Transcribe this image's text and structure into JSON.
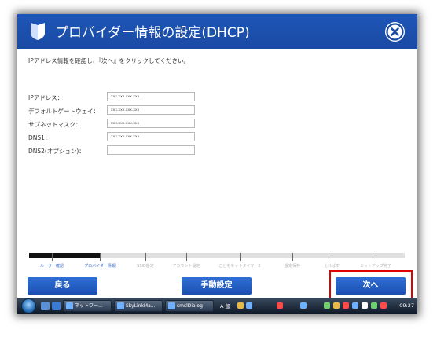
{
  "window": {
    "title": "プロバイダー情報の設定(DHCP)",
    "logo_icon": "shield-icon",
    "close_icon": "close-circle-icon"
  },
  "instruction": "IPアドレス情報を確認し、『次へ』をクリックしてください。",
  "form": [
    {
      "label": "IPアドレス：",
      "value": "xxx.xxx.xxx.xxx"
    },
    {
      "label": "デフォルトゲートウェイ：",
      "value": "xxx.xxx.xxx.xxx"
    },
    {
      "label": "サブネットマスク：",
      "value": "xxx.xxx.xxx.xxx"
    },
    {
      "label": "DNS1：",
      "value": "xxx.xxx.xxx.xxx"
    },
    {
      "label": "DNS2(オプション)：",
      "value": ""
    }
  ],
  "progress": {
    "fraction": 0.19,
    "steps": [
      {
        "label": "ルーター確認",
        "done": true
      },
      {
        "label": "プロバイダー情報",
        "done": true
      },
      {
        "label": "SSID設定",
        "done": false
      },
      {
        "label": "アカウント設定",
        "done": false
      },
      {
        "label": "こどもネットタイマー2",
        "done": false
      },
      {
        "label": "設定保存",
        "done": false
      },
      {
        "label": "えれぱす",
        "done": false
      },
      {
        "label": "セットアップ完了",
        "done": false
      }
    ]
  },
  "buttons": {
    "back": "戻る",
    "manual": "手動設定",
    "next": "次へ"
  },
  "colors": {
    "title_bar": "#1e56b8",
    "button": "#2461c4",
    "highlight": "#e00000"
  },
  "taskbar": {
    "items": [
      "ネットワー...",
      "SkyLinkMa...",
      "smslDialog"
    ],
    "ime": "A 般",
    "clock": "09:27"
  }
}
